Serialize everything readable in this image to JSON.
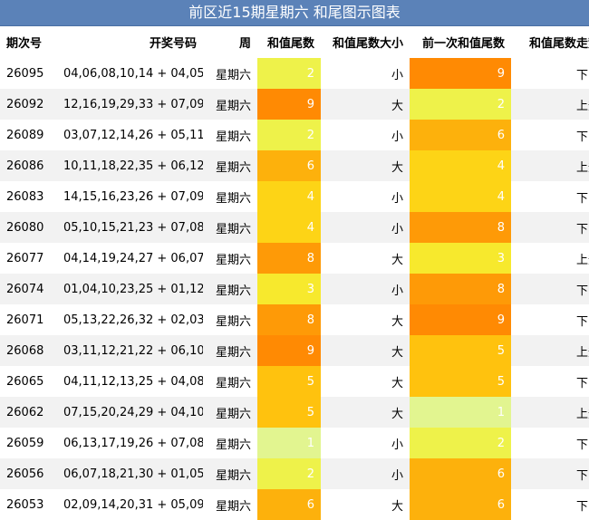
{
  "title": "前区近15期星期六 和尾图示图表",
  "headers": {
    "issue": "期次号",
    "numbers": "开奖号码",
    "weekday": "周",
    "sum_tail": "和值尾数",
    "sum_size": "和值尾数大小",
    "prev_tail": "前一次和值尾数",
    "trend": "和值尾数走势"
  },
  "colors": {
    "v1": "#e2f590",
    "v2": "#eef24a",
    "v3": "#f7e92d",
    "v4": "#fdd416",
    "v5": "#ffc20e",
    "v6": "#fdb10c",
    "v8": "#fe9a07",
    "v9": "#ff8a03"
  },
  "rows": [
    {
      "issue": "26095",
      "numbers": "04,06,08,10,14 + 04,05",
      "weekday": "星期六",
      "sum_tail": "2",
      "sum_size": "小",
      "prev_tail": "9",
      "trend": "下降"
    },
    {
      "issue": "26092",
      "numbers": "12,16,19,29,33 + 07,09",
      "weekday": "星期六",
      "sum_tail": "9",
      "sum_size": "大",
      "prev_tail": "2",
      "trend": "上升"
    },
    {
      "issue": "26089",
      "numbers": "03,07,12,14,26 + 05,11",
      "weekday": "星期六",
      "sum_tail": "2",
      "sum_size": "小",
      "prev_tail": "6",
      "trend": "下降"
    },
    {
      "issue": "26086",
      "numbers": "10,11,18,22,35 + 06,12",
      "weekday": "星期六",
      "sum_tail": "6",
      "sum_size": "大",
      "prev_tail": "4",
      "trend": "上升"
    },
    {
      "issue": "26083",
      "numbers": "14,15,16,23,26 + 07,09",
      "weekday": "星期六",
      "sum_tail": "4",
      "sum_size": "小",
      "prev_tail": "4",
      "trend": "下降"
    },
    {
      "issue": "26080",
      "numbers": "05,10,15,21,23 + 07,08",
      "weekday": "星期六",
      "sum_tail": "4",
      "sum_size": "小",
      "prev_tail": "8",
      "trend": "下降"
    },
    {
      "issue": "26077",
      "numbers": "04,14,19,24,27 + 06,07",
      "weekday": "星期六",
      "sum_tail": "8",
      "sum_size": "大",
      "prev_tail": "3",
      "trend": "上升"
    },
    {
      "issue": "26074",
      "numbers": "01,04,10,23,25 + 01,12",
      "weekday": "星期六",
      "sum_tail": "3",
      "sum_size": "小",
      "prev_tail": "8",
      "trend": "下降"
    },
    {
      "issue": "26071",
      "numbers": "05,13,22,26,32 + 02,03",
      "weekday": "星期六",
      "sum_tail": "8",
      "sum_size": "大",
      "prev_tail": "9",
      "trend": "下降"
    },
    {
      "issue": "26068",
      "numbers": "03,11,12,21,22 + 06,10",
      "weekday": "星期六",
      "sum_tail": "9",
      "sum_size": "大",
      "prev_tail": "5",
      "trend": "上升"
    },
    {
      "issue": "26065",
      "numbers": "04,11,12,13,25 + 04,08",
      "weekday": "星期六",
      "sum_tail": "5",
      "sum_size": "大",
      "prev_tail": "5",
      "trend": "下降"
    },
    {
      "issue": "26062",
      "numbers": "07,15,20,24,29 + 04,10",
      "weekday": "星期六",
      "sum_tail": "5",
      "sum_size": "大",
      "prev_tail": "1",
      "trend": "上升"
    },
    {
      "issue": "26059",
      "numbers": "06,13,17,19,26 + 07,08",
      "weekday": "星期六",
      "sum_tail": "1",
      "sum_size": "小",
      "prev_tail": "2",
      "trend": "下降"
    },
    {
      "issue": "26056",
      "numbers": "06,07,18,21,30 + 01,05",
      "weekday": "星期六",
      "sum_tail": "2",
      "sum_size": "小",
      "prev_tail": "6",
      "trend": "下降"
    },
    {
      "issue": "26053",
      "numbers": "02,09,14,20,31 + 05,09",
      "weekday": "星期六",
      "sum_tail": "6",
      "sum_size": "大",
      "prev_tail": "6",
      "trend": "下降"
    }
  ]
}
